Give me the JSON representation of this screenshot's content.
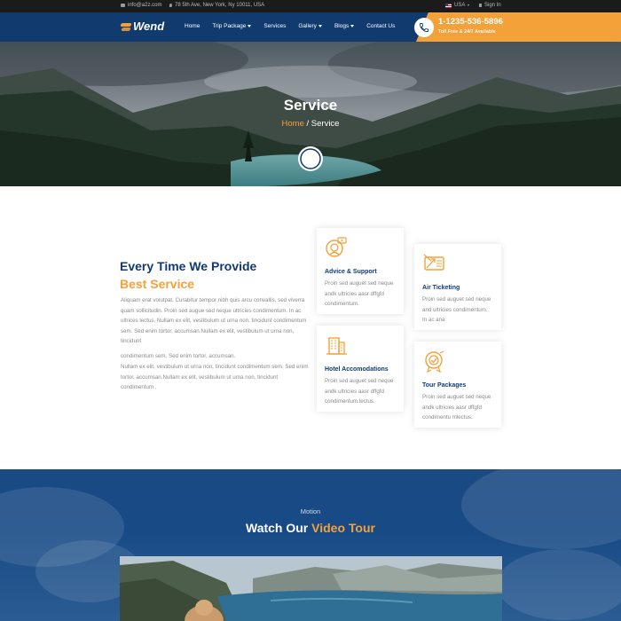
{
  "topbar": {
    "email": "info@a2z.com",
    "address": "78 5th Ave, New York, Ny 10011, USA",
    "language": "USA",
    "signin": "Sign In"
  },
  "brand": {
    "name": "Wend"
  },
  "nav": {
    "items": [
      {
        "label": "Home",
        "has_dropdown": false
      },
      {
        "label": "Trip Package",
        "has_dropdown": true
      },
      {
        "label": "Services",
        "has_dropdown": false
      },
      {
        "label": "Gallery",
        "has_dropdown": true
      },
      {
        "label": "Blogs",
        "has_dropdown": true
      },
      {
        "label": "Contact Us",
        "has_dropdown": false
      }
    ]
  },
  "contact": {
    "phone": "1-1235-536-5896",
    "subtitle": "Toll Free & 24/7 Available"
  },
  "hero": {
    "title": "Service",
    "breadcrumb_home": "Home",
    "breadcrumb_sep": " / ",
    "breadcrumb_current": "Service"
  },
  "services": {
    "heading_line1": "Every Time We Provide",
    "heading_line2": "Best Service",
    "para1": "Aliquam erat volutpat. Curabitur tempor  nibh quis arcu convallis, sed viverra quam sollicitudin. Proin sed augue sed neque ultricies condimentum. In ac ultrices lectus. Nullam ex elit, vestibulum ut urna non, tincidunt condimentum sem. Sed enim tortor, accumsan.Nullam ex elit, vestibulum ut urna non, tincidunt",
    "para2": "condimentum sem. Sed enim tortor, accumsan.",
    "para3": "Nullam ex elit, vestibulum ut urna non, tincidunt condimentum sem. Sed enim tortor, accumsan.Nullam ex elit, vestibulum ut urna non, tincidunt condimentum .",
    "cards": [
      {
        "title": "Advice & Support",
        "text": "Proin sed auguet sed neque andk ultricies aasr dffgfd condimentum.",
        "icon": "support-agent-icon"
      },
      {
        "title": "Air Ticketing",
        "text": "Proin sed auguet sed neque and ultricies condimentum. In ac  ana",
        "icon": "air-ticket-icon"
      },
      {
        "title": "Hotel Accomodations",
        "text": "Proin sed auguet sed neque andk ultricies aasr dffgfd condimentum.lectus.",
        "icon": "hotel-building-icon"
      },
      {
        "title": "Tour Packages",
        "text": "Proin sed auguet sed neque andk ultricies aasr dffgfd condimentu  mlectus.",
        "icon": "tour-badge-icon"
      }
    ]
  },
  "video": {
    "kicker": "Motion",
    "title_prefix": "Watch Our ",
    "title_highlight": "Video Tour"
  },
  "colors": {
    "navy": "#113a6e",
    "orange": "#f4a13a",
    "topbar": "#1b1b1b",
    "text_gray": "#8a8a8a"
  }
}
